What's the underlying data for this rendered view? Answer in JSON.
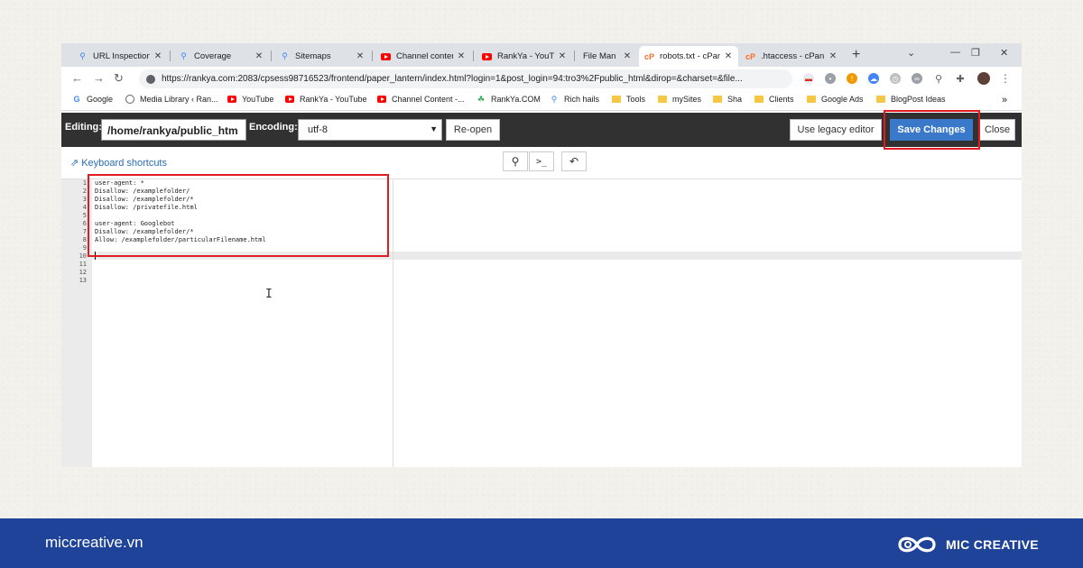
{
  "browser": {
    "tabs": [
      {
        "label": "URL Inspection",
        "icon": "search-console-icon"
      },
      {
        "label": "Coverage",
        "icon": "search-console-icon"
      },
      {
        "label": "Sitemaps",
        "icon": "search-console-icon"
      },
      {
        "label": "Channel conten",
        "icon": "youtube-icon"
      },
      {
        "label": "RankYa - YouTu",
        "icon": "youtube-icon"
      },
      {
        "label": "File Man",
        "icon": "cpanel-icon"
      },
      {
        "label": "robots.txt - cPan",
        "icon": "cpanel-icon",
        "active": true
      },
      {
        "label": ".htaccess - cPan",
        "icon": "cpanel-icon"
      }
    ],
    "url": "https://rankya.com:2083/cpsess98716523/frontend/paper_lantern/index.html?login=1&post_login=94:tro3%2Fpublic_html&dirop=&charset=&file...",
    "bookmarks": [
      {
        "label": "Google",
        "icon": "google-icon"
      },
      {
        "label": "Media Library ‹ Ran...",
        "icon": "globe-icon"
      },
      {
        "label": "YouTube",
        "icon": "youtube-icon"
      },
      {
        "label": "RankYa - YouTube",
        "icon": "youtube-icon"
      },
      {
        "label": "Channel Content -...",
        "icon": "youtube-icon"
      },
      {
        "label": "RankYa.COM",
        "icon": "rankya-icon"
      },
      {
        "label": "Rich hails",
        "icon": "search-console-icon"
      },
      {
        "label": "Tools",
        "icon": "folder-icon"
      },
      {
        "label": "mySites",
        "icon": "folder-icon"
      },
      {
        "label": "Sha",
        "icon": "folder-icon"
      },
      {
        "label": "Clients",
        "icon": "folder-icon"
      },
      {
        "label": "Google Ads",
        "icon": "folder-icon"
      },
      {
        "label": "BlogPost Ideas",
        "icon": "folder-icon"
      }
    ],
    "bookmarks_more": "»"
  },
  "editor": {
    "editing_label": "Editing:",
    "path_value": "/home/rankya/public_htm",
    "encoding_label": "Encoding:",
    "encoding_value": "utf-8",
    "reopen_label": "Re-open",
    "legacy_label": "Use legacy editor",
    "save_label": "Save Changes",
    "close_label": "Close",
    "shortcuts_label": "Keyboard shortcuts",
    "lines": [
      "user-agent: *",
      "Disallow: /examplefolder/",
      "Disallow: /examplefolder/*",
      "Disallow: /privatefile.html",
      "",
      "user-agent: Googlebot",
      "Disallow: /examplefolder/*",
      "Allow: /examplefolder/particularFilename.html",
      "",
      "",
      "",
      "",
      ""
    ],
    "line_numbers": [
      "1",
      "2",
      "3",
      "4",
      "5",
      "6",
      "7",
      "8",
      "9",
      "10",
      "11",
      "12",
      "13"
    ],
    "active_line": 10
  },
  "footer": {
    "site": "miccreative.vn",
    "brand": "MIC CREATIVE"
  },
  "colors": {
    "highlight": "#e01b22",
    "save_button": "#3a78c9",
    "footer_bg": "#1f4398",
    "editor_header": "#313131"
  }
}
